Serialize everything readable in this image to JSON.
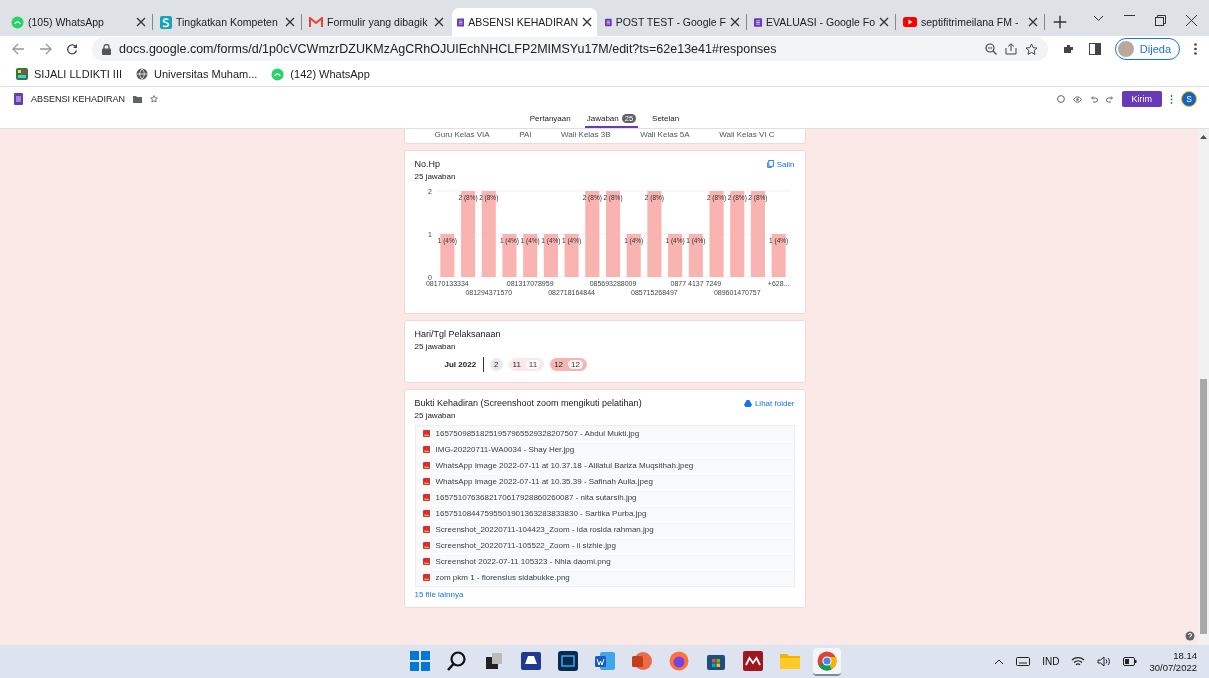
{
  "browser": {
    "tabs": [
      {
        "title": "(105) WhatsApp",
        "selected": false
      },
      {
        "title": "Tingkatkan Kompeten",
        "selected": false
      },
      {
        "title": "Formulir yang dibagik",
        "selected": false
      },
      {
        "title": "ABSENSI KEHADIRAN",
        "selected": true
      },
      {
        "title": "POST TEST - Google F",
        "selected": false
      },
      {
        "title": "EVALUASI - Google Fo",
        "selected": false
      },
      {
        "title": "septifitrimeilana FM -",
        "selected": false
      }
    ],
    "url": "docs.google.com/forms/d/1p0cVCWmzrDZUKMzAgCRhOJUIEchNHCLFP2MIMSYu17M/edit?ts=62e13e41#responses",
    "profile": "Dijeda",
    "bookmarks": [
      {
        "label": "SIJALI LLDIKTI III"
      },
      {
        "label": "Universitas Muham..."
      },
      {
        "label": "(142) WhatsApp"
      }
    ]
  },
  "form": {
    "title": "ABSENSI KEHADIRAN",
    "send": "Kirim",
    "avatar": "S",
    "tabs": [
      {
        "label": "Pertanyaan",
        "selected": false
      },
      {
        "label": "Jawaban",
        "badge": "25",
        "selected": true
      },
      {
        "label": "Setelan",
        "selected": false
      }
    ]
  },
  "prev_card": {
    "labels": [
      "Guru Kelas VIA",
      "PAI",
      "Wali Kelas 3B",
      "Wali Kelas 5A",
      "Wali Kelas VI C"
    ]
  },
  "phone_card": {
    "title": "No.Hp",
    "count": "25 jawaban",
    "copy": "Salin",
    "chart_data": {
      "type": "bar",
      "categories": [
        "08170133334",
        null,
        "081294371570",
        null,
        "081317078959",
        null,
        "082718164844",
        null,
        "085693288009",
        null,
        "085715268497",
        null,
        "0877 4137 7249",
        null,
        "089601470757",
        null,
        "+628..."
      ],
      "values": [
        1,
        2,
        2,
        1,
        1,
        1,
        1,
        2,
        2,
        1,
        2,
        1,
        1,
        2,
        2,
        2,
        1
      ],
      "value_labels": [
        "1 (4%)",
        "2 (8%)",
        "2 (8%)",
        "1 (4%)",
        "1 (4%)",
        "1 (4%)",
        "1 (4%)",
        "2 (8%)",
        "2 (8%)",
        "1 (4%)",
        "2 (8%)",
        "1 (4%)",
        "1 (4%)",
        "2 (8%)",
        "2 (8%)",
        "2 (8%)",
        "1 (4%)"
      ],
      "ylim": [
        0,
        2
      ],
      "yticks": [
        0,
        1,
        2
      ]
    }
  },
  "date_card": {
    "title": "Hari/Tgl Pelaksanaan",
    "count": "25 jawaban",
    "month": "Jul 2022",
    "days": [
      {
        "day": "2",
        "color": "#e8eaed"
      },
      {
        "day": "11",
        "count": "11",
        "color": "#fce8e6"
      },
      {
        "day": "12",
        "count": "12",
        "color": "#f5b5b3"
      }
    ]
  },
  "files_card": {
    "title": "Bukti Kehadiran (Screenshoot zoom mengikuti pelatihan)",
    "count": "25 jawaban",
    "folder": "Lihat folder",
    "files": [
      "16575098518251957965529328207507 - Abdul Mukti.jpg",
      "IMG-20220711-WA0034 - Shay Her.jpg",
      "WhatsApp Image 2022-07-11 at 10.37.18 - Alilatul Bariza Muqsithah.jpeg",
      "WhatsApp Image 2022-07-11 at 10.35.39 - Safinah Aulia.jpeg",
      "1657510763682170617928860260087 - nita sutarsih.jpg",
      "16575108447595501901363283833830 - Sartika Purba.jpg",
      "Screenshot_20220711-104423_Zoom - ida rosida rahman.jpg",
      "Screenshot_20220711-105522_Zoom - ii sizhie.jpg",
      "Screenshot 2022-07-11 105323 - Nhla daomi.png",
      "zom pkm 1 - florensius sidabukke.png"
    ],
    "more": "15 file lainnya"
  },
  "taskbar": {
    "apps": [
      {
        "selected": false
      },
      {
        "selected": false
      },
      {
        "selected": false
      },
      {
        "selected": false
      },
      {
        "selected": false
      },
      {
        "selected": false
      },
      {
        "selected": false
      },
      {
        "selected": false
      },
      {
        "selected": false
      },
      {
        "selected": false
      },
      {
        "selected": false
      },
      {
        "selected": true
      }
    ],
    "language": "IND",
    "time": "18.14",
    "date": "30/07/2022"
  }
}
